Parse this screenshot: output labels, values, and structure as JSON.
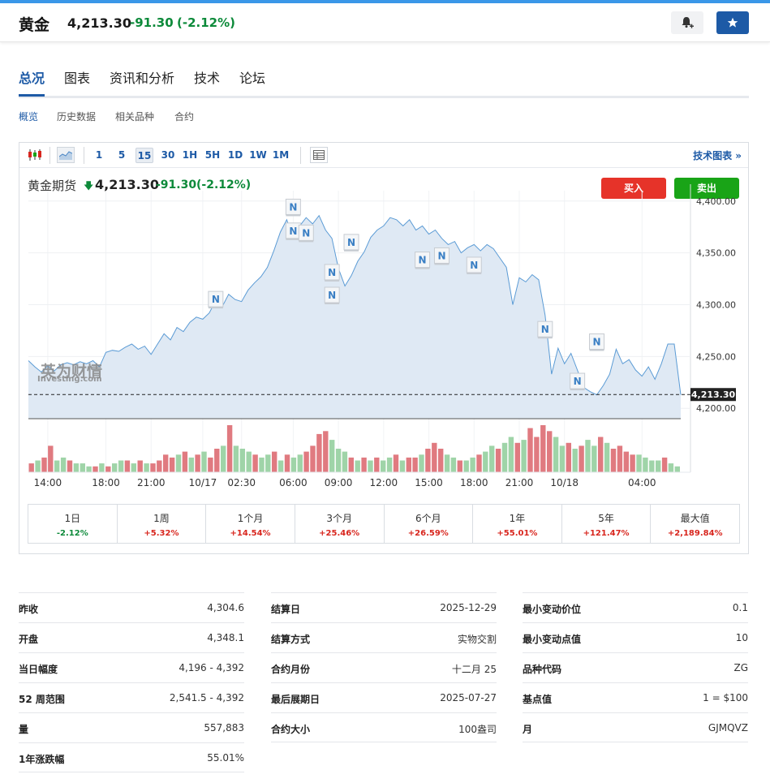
{
  "header": {
    "title": "黄金",
    "price": "4,213.30",
    "change": "-91.30",
    "change_pct": "(-2.12%)"
  },
  "tabs": [
    {
      "label": "总况",
      "active": true
    },
    {
      "label": "图表"
    },
    {
      "label": "资讯和分析"
    },
    {
      "label": "技术"
    },
    {
      "label": "论坛"
    }
  ],
  "subtabs": [
    {
      "label": "概览",
      "active": true
    },
    {
      "label": "历史数据"
    },
    {
      "label": "相关品种"
    },
    {
      "label": "合约"
    }
  ],
  "toolbar": {
    "intervals": [
      "1",
      "5",
      "15",
      "30",
      "1H",
      "5H",
      "1D",
      "1W",
      "1M"
    ],
    "selected_interval": "15",
    "tech_chart_link": "技术图表 »"
  },
  "chart_info": {
    "name": "黄金期货",
    "price": "4,213.30",
    "change": "-91.30",
    "change_pct": "(-2.12%)",
    "buy_label": "买入",
    "sell_label": "卖出",
    "watermark_cn": "英为财情",
    "watermark_en": "Investing.com",
    "news_marker": "N"
  },
  "chart_data": {
    "type": "area",
    "title": "",
    "xlabel": "",
    "ylabel": "",
    "x_ticks": [
      "14:00",
      "18:00",
      "21:00",
      "10/17",
      "02:30",
      "06:00",
      "09:00",
      "12:00",
      "15:00",
      "18:00",
      "21:00",
      "10/18",
      "04:00"
    ],
    "y_ticks": [
      "4,400.00",
      "4,350.00",
      "4,300.00",
      "4,250.00",
      "4,200.00"
    ],
    "ylim": [
      4190,
      4410
    ],
    "current_price_label": "4,213.30",
    "current_price": 4213.3,
    "series": [
      {
        "values": [
          4246,
          4240,
          4235,
          4241,
          4236,
          4242,
          4244,
          4242,
          4245,
          4243,
          4246,
          4240,
          4254,
          4256,
          4255,
          4259,
          4262,
          4257,
          4260,
          4252,
          4262,
          4272,
          4266,
          4278,
          4274,
          4283,
          4288,
          4286,
          4292,
          4304,
          4298,
          4310,
          4305,
          4303,
          4314,
          4321,
          4327,
          4336,
          4352,
          4370,
          4382,
          4364,
          4376,
          4384,
          4378,
          4386,
          4372,
          4364,
          4335,
          4318,
          4328,
          4342,
          4351,
          4365,
          4372,
          4376,
          4384,
          4382,
          4376,
          4382,
          4372,
          4376,
          4368,
          4372,
          4364,
          4358,
          4361,
          4350,
          4355,
          4358,
          4352,
          4358,
          4354,
          4345,
          4336,
          4300,
          4326,
          4322,
          4329,
          4324,
          4290,
          4233,
          4258,
          4243,
          4253,
          4237,
          4220,
          4216,
          4213,
          4222,
          4233,
          4257,
          4243,
          4247,
          4237,
          4231,
          4240,
          4228,
          4243,
          4262,
          4262,
          4213
        ]
      }
    ],
    "news_markers": [
      {
        "x_index": 29,
        "value": 4305
      },
      {
        "x_index": 41,
        "value": 4394
      },
      {
        "x_index": 41,
        "value": 4371
      },
      {
        "x_index": 43,
        "value": 4369
      },
      {
        "x_index": 47,
        "value": 4331
      },
      {
        "x_index": 47,
        "value": 4309
      },
      {
        "x_index": 50,
        "value": 4360
      },
      {
        "x_index": 61,
        "value": 4343
      },
      {
        "x_index": 64,
        "value": 4347
      },
      {
        "x_index": 69,
        "value": 4338
      },
      {
        "x_index": 80,
        "value": 4276
      },
      {
        "x_index": 85,
        "value": 4226
      },
      {
        "x_index": 88,
        "value": 4264
      }
    ],
    "volume": {
      "values": [
        3,
        4,
        5,
        9,
        4,
        5,
        4,
        3,
        3,
        2,
        2,
        3,
        2,
        3,
        4,
        4,
        3,
        4,
        3,
        3,
        4,
        6,
        5,
        6,
        7,
        5,
        6,
        7,
        5,
        8,
        9,
        16,
        9,
        8,
        7,
        6,
        5,
        6,
        7,
        4,
        6,
        5,
        6,
        7,
        9,
        13,
        14,
        11,
        8,
        7,
        5,
        4,
        5,
        4,
        5,
        4,
        5,
        6,
        4,
        5,
        5,
        6,
        8,
        10,
        8,
        6,
        5,
        4,
        4,
        5,
        6,
        7,
        9,
        8,
        10,
        12,
        10,
        11,
        15,
        12,
        16,
        14,
        12,
        9,
        10,
        8,
        9,
        11,
        9,
        12,
        10,
        8,
        9,
        7,
        6,
        6,
        5,
        4,
        4,
        5,
        3,
        2
      ],
      "colors": [
        "r",
        "g",
        "r",
        "r",
        "g",
        "g",
        "r",
        "g",
        "g",
        "g",
        "r",
        "g",
        "r",
        "g",
        "g",
        "r",
        "g",
        "r",
        "g",
        "r",
        "r",
        "r",
        "r",
        "g",
        "r",
        "g",
        "r",
        "g",
        "r",
        "r",
        "g",
        "r",
        "g",
        "g",
        "g",
        "r",
        "g",
        "g",
        "r",
        "g",
        "r",
        "g",
        "g",
        "r",
        "r",
        "r",
        "r",
        "g",
        "g",
        "g",
        "r",
        "g",
        "r",
        "g",
        "r",
        "g",
        "g",
        "r",
        "g",
        "r",
        "r",
        "g",
        "r",
        "r",
        "r",
        "g",
        "g",
        "r",
        "g",
        "g",
        "r",
        "g",
        "g",
        "r",
        "g",
        "g",
        "r",
        "g",
        "r",
        "r",
        "r",
        "r",
        "g",
        "g",
        "r",
        "g",
        "r",
        "g",
        "g",
        "r",
        "g",
        "r",
        "r",
        "r",
        "r",
        "g",
        "g",
        "g",
        "g",
        "r",
        "g",
        "g"
      ]
    }
  },
  "performance": [
    {
      "label": "1日",
      "value": "-2.12%",
      "color": "#0d8a3a"
    },
    {
      "label": "1周",
      "value": "+5.32%",
      "color": "#d8261e"
    },
    {
      "label": "1个月",
      "value": "+14.54%",
      "color": "#d8261e"
    },
    {
      "label": "3个月",
      "value": "+25.46%",
      "color": "#d8261e"
    },
    {
      "label": "6个月",
      "value": "+26.59%",
      "color": "#d8261e"
    },
    {
      "label": "1年",
      "value": "+55.01%",
      "color": "#d8261e"
    },
    {
      "label": "5年",
      "value": "+121.47%",
      "color": "#d8261e"
    },
    {
      "label": "最大值",
      "value": "+2,189.84%",
      "color": "#d8261e"
    }
  ],
  "stats": [
    [
      {
        "label": "昨收",
        "value": "4,304.6"
      },
      {
        "label": "开盘",
        "value": "4,348.1"
      },
      {
        "label": "当日幅度",
        "value": "4,196 - 4,392"
      },
      {
        "label": "52 周范围",
        "value": "2,541.5 - 4,392"
      },
      {
        "label": "量",
        "value": "557,883"
      },
      {
        "label": "1年涨跌幅",
        "value": "55.01%"
      }
    ],
    [
      {
        "label": "结算日",
        "value": "2025-12-29"
      },
      {
        "label": "结算方式",
        "value": "实物交割"
      },
      {
        "label": "合约月份",
        "value": "十二月 25"
      },
      {
        "label": "最后展期日",
        "value": "2025-07-27"
      },
      {
        "label": "合约大小",
        "value": "100盎司"
      }
    ],
    [
      {
        "label": "最小变动价位",
        "value": "0.1"
      },
      {
        "label": "最小变动点值",
        "value": "10"
      },
      {
        "label": "品种代码",
        "value": "ZG"
      },
      {
        "label": "基点值",
        "value": "1 = $100"
      },
      {
        "label": "月",
        "value": "GJMQVZ"
      }
    ]
  ],
  "colors": {
    "accent": "#1d5aa6",
    "up_green": "#0d8a3a",
    "down_red": "#d8261e",
    "buy": "#e63329",
    "sell": "#19a417"
  }
}
